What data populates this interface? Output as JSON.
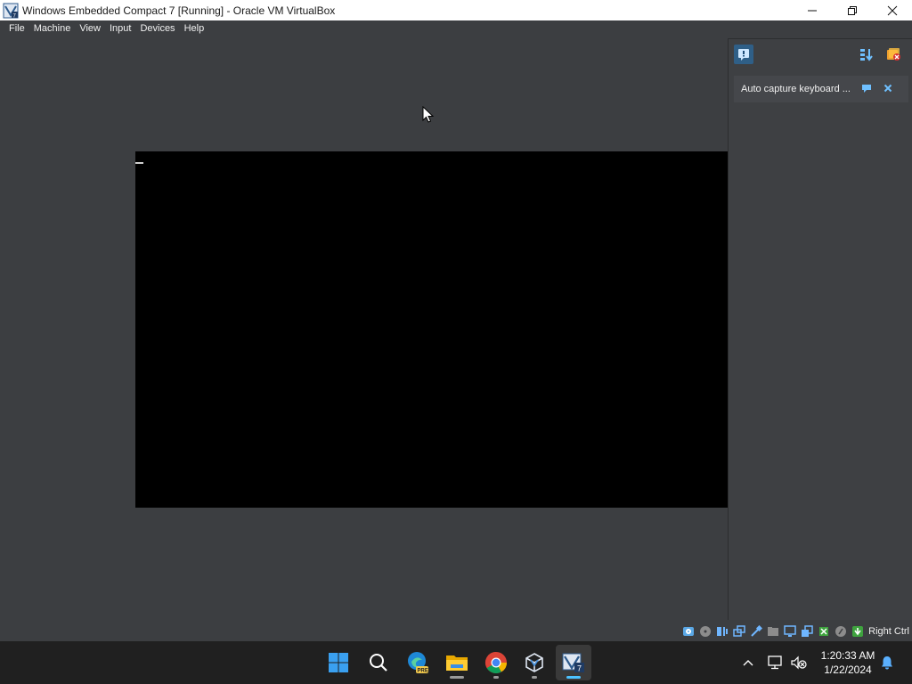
{
  "window": {
    "title": "Windows Embedded Compact 7 [Running] - Oracle VM VirtualBox",
    "minimize_icon": "minimize-icon",
    "maximize_icon": "restore-icon",
    "close_icon": "close-icon"
  },
  "menu": {
    "items": [
      "File",
      "Machine",
      "View",
      "Input",
      "Devices",
      "Help"
    ]
  },
  "notification_center": {
    "toggle_icon": "notification-center-icon",
    "sort_icon": "sort-icon",
    "clear_icon": "clear-all-icon",
    "items": [
      {
        "text": "Auto capture keyboard ...",
        "help_icon": "help-bubble-icon",
        "close_icon": "close-x-icon"
      }
    ]
  },
  "status_bar": {
    "icons": [
      "hard-disk-icon",
      "optical-drive-icon",
      "audio-icon",
      "network-icon",
      "usb-icon",
      "shared-folders-icon",
      "display-icon",
      "recording-icon",
      "cpu-icon",
      "mouse-integration-icon",
      "keyboard-icon"
    ],
    "host_key": "Right Ctrl"
  },
  "taskbar": {
    "apps": [
      "start-icon",
      "search-icon",
      "edge-preview-icon",
      "file-explorer-icon",
      "chrome-icon",
      "virtualbox-icon",
      "vm-window-icon"
    ],
    "tray_icons": [
      "chevron-up-icon",
      "network-icon",
      "volume-muted-icon",
      "notification-bell-icon"
    ],
    "time": "1:20:33 AM",
    "date": "1/22/2024"
  },
  "colors": {
    "accent": "#4cc2ff",
    "vm_background": "#3c3e41",
    "guest_screen": "#000000"
  }
}
